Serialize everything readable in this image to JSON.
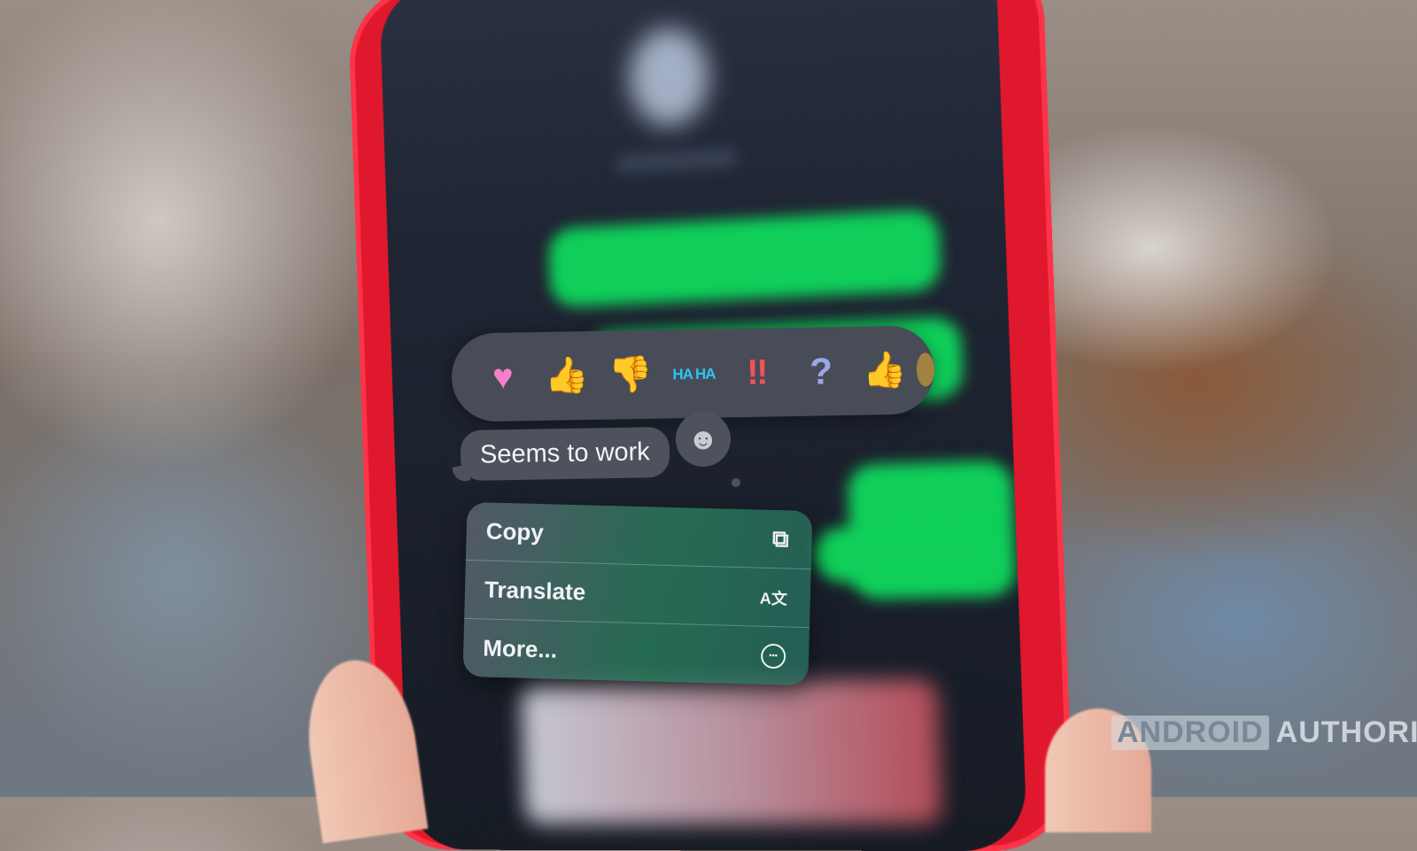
{
  "scene": {
    "description": "Red iPhone showing iMessage tapback reactions menu",
    "phone_color": "#e0182d",
    "message_bubble_color": "#0fcf5a"
  },
  "reactions": [
    {
      "name": "heart",
      "glyph": "♥"
    },
    {
      "name": "thumbs-up",
      "glyph": "👍"
    },
    {
      "name": "thumbs-down",
      "glyph": "👎"
    },
    {
      "name": "haha",
      "glyph": "HA HA"
    },
    {
      "name": "exclamation",
      "glyph": "‼"
    },
    {
      "name": "question",
      "glyph": "?"
    },
    {
      "name": "thumbs-up-emoji",
      "glyph": "👍"
    }
  ],
  "message": {
    "text": "Seems to work",
    "emoji_button_glyph": "☻"
  },
  "context_menu": {
    "items": [
      {
        "label": "Copy",
        "icon": "copy-icon",
        "glyph": "⧉"
      },
      {
        "label": "Translate",
        "icon": "translate-icon",
        "glyph": "A文"
      },
      {
        "label": "More...",
        "icon": "more-icon",
        "glyph": "•••"
      }
    ]
  },
  "watermark": {
    "boxed": "ANDROID",
    "text": "AUTHORITY"
  }
}
